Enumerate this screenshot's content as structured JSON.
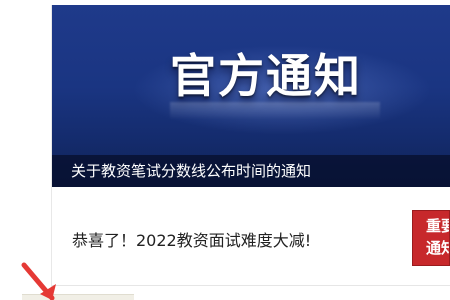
{
  "banner": {
    "title": "官方通知",
    "caption": "关于教资笔试分数线公布时间的通知"
  },
  "news": {
    "headline": "恭喜了！2022教资面试难度大减!"
  },
  "badge": {
    "line1": "重要",
    "line2": "通知"
  },
  "icons": {
    "pointer": "red-arrow-icon"
  },
  "colors": {
    "banner_blue": "#1a3582",
    "badge_red": "#c7282b",
    "arrow_red": "#e53935"
  }
}
